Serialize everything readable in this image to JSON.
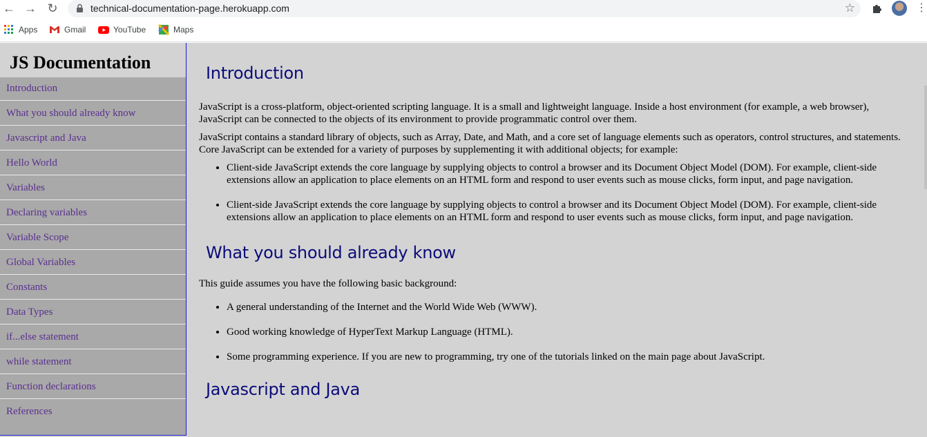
{
  "browser": {
    "url": "technical-documentation-page.herokuapp.com",
    "bookmarks": [
      {
        "label": "Apps",
        "icon": "apps-grid-icon"
      },
      {
        "label": "Gmail",
        "icon": "gmail-icon"
      },
      {
        "label": "YouTube",
        "icon": "youtube-icon"
      },
      {
        "label": "Maps",
        "icon": "maps-icon"
      }
    ]
  },
  "sidebar": {
    "title": "JS Documentation",
    "items": [
      "Introduction",
      "What you should already know",
      "Javascript and Java",
      "Hello World",
      "Variables",
      "Declaring variables",
      "Variable Scope",
      "Global Variables",
      "Constants",
      "Data Types",
      "if...else statement",
      "while statement",
      "Function declarations",
      "References"
    ]
  },
  "main": {
    "intro": {
      "title": "Introduction",
      "p1": "JavaScript is a cross-platform, object-oriented scripting language. It is a small and lightweight language. Inside a host environment (for example, a web browser), JavaScript can be connected to the objects of its environment to provide programmatic control over them.",
      "p2": "JavaScript contains a standard library of objects, such as Array, Date, and Math, and a core set of language elements such as operators, control structures, and statements. Core JavaScript can be extended for a variety of purposes by supplementing it with additional objects; for example:",
      "bullets": [
        "Client-side JavaScript extends the core language by supplying objects to control a browser and its Document Object Model (DOM). For example, client-side extensions allow an application to place elements on an HTML form and respond to user events such as mouse clicks, form input, and page navigation.",
        "Client-side JavaScript extends the core language by supplying objects to control a browser and its Document Object Model (DOM). For example, client-side extensions allow an application to place elements on an HTML form and respond to user events such as mouse clicks, form input, and page navigation."
      ]
    },
    "know": {
      "title": "What you should already know",
      "p1": "This guide assumes you have the following basic background:",
      "bullets": [
        "A general understanding of the Internet and the World Wide Web (WWW).",
        "Good working knowledge of HyperText Markup Language (HTML).",
        "Some programming experience. If you are new to programming, try one of the tutorials linked on the main page about JavaScript."
      ]
    },
    "java": {
      "title": "Javascript and Java"
    }
  }
}
